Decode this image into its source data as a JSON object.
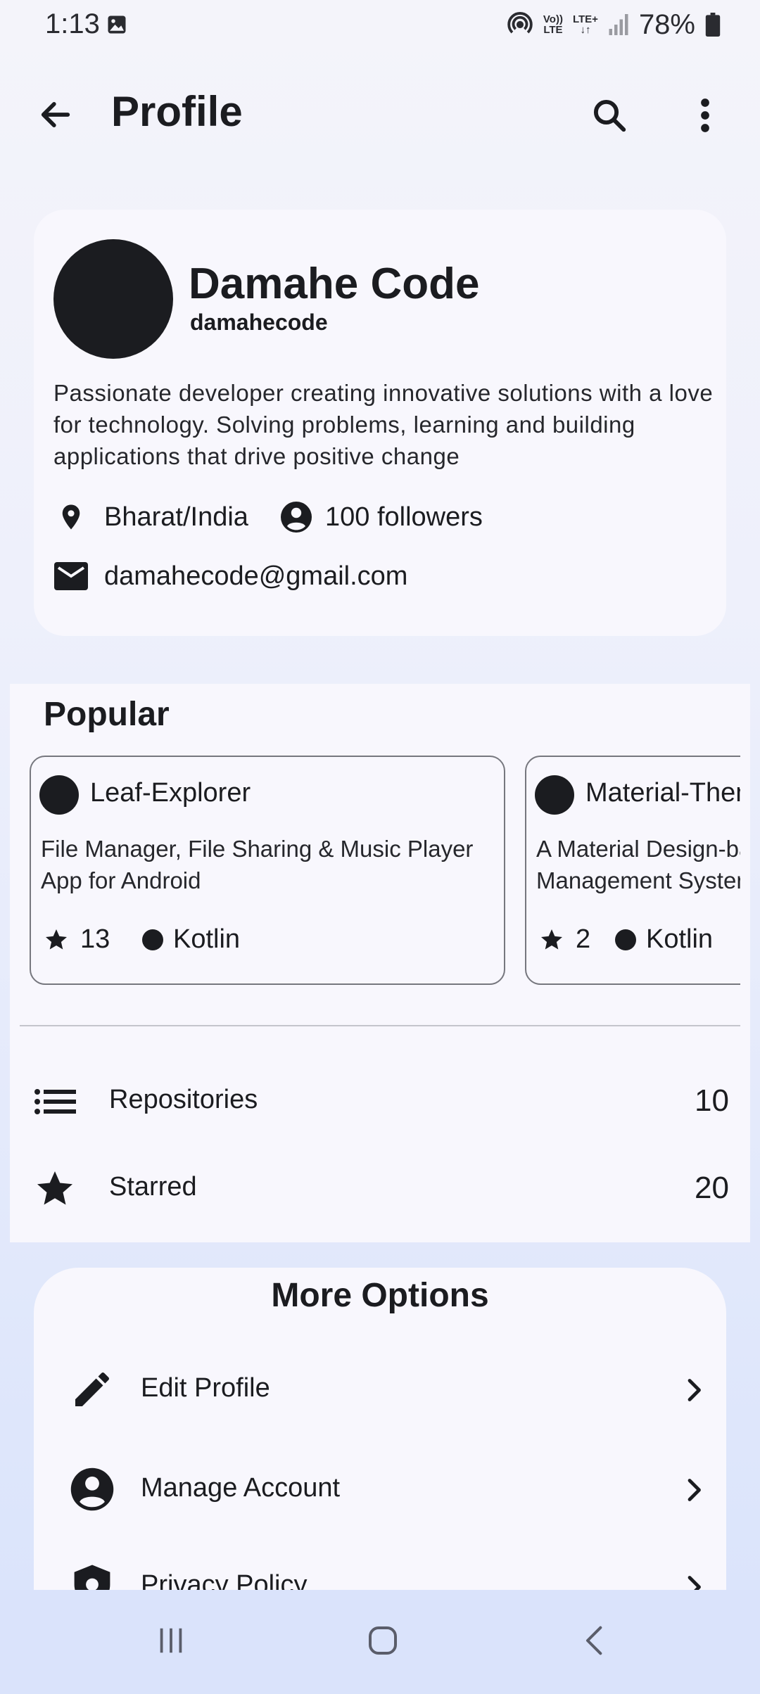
{
  "status_bar": {
    "time": "1:13",
    "volte": "Vo))",
    "volte_sub": "LTE",
    "network": "LTE+",
    "battery": "78%"
  },
  "app_bar": {
    "title": "Profile",
    "icons": [
      "back-arrow-icon",
      "search-icon",
      "more-vert-icon"
    ]
  },
  "profile": {
    "name": "Damahe Code",
    "handle": "damahecode",
    "bio": "Passionate developer creating innovative solutions with a love for technology. Solving problems, learning and building applications that drive positive change",
    "location": "Bharat/India",
    "followers": "100 followers",
    "email": "damahecode@gmail.com"
  },
  "popular": {
    "title": "Popular",
    "repos": [
      {
        "name": "Leaf-Explorer",
        "description": "File Manager, File Sharing & Music Player App for Android",
        "stars": "13",
        "language": "Kotlin"
      },
      {
        "name": "Material-Theme",
        "description": "A Material Design-based Theme Management System",
        "stars": "2",
        "language": "Kotlin"
      }
    ]
  },
  "stats": [
    {
      "label": "Repositories",
      "count": "10",
      "icon": "list-icon"
    },
    {
      "label": "Starred",
      "count": "20",
      "icon": "star-icon"
    }
  ],
  "more_options": {
    "title": "More Options",
    "items": [
      {
        "label": "Edit Profile",
        "icon": "edit-pencil-icon"
      },
      {
        "label": "Manage Account",
        "icon": "account-circle-icon"
      },
      {
        "label": "Privacy Policy",
        "icon": "privacy-shield-icon"
      }
    ]
  },
  "colors": {
    "ink": "#1b1c20",
    "card": "#f8f7fd",
    "nav": "#dae3fb"
  }
}
